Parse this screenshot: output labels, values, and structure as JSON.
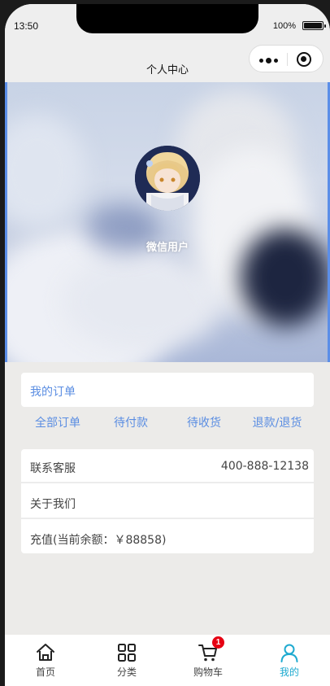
{
  "status_bar": {
    "time": "13:50",
    "battery_text": "100%",
    "battery_level": 1.0
  },
  "nav": {
    "title": "个人中心"
  },
  "profile": {
    "username": "微信用户"
  },
  "orders": {
    "title": "我的订单",
    "tabs": [
      "全部订单",
      "待付款",
      "待收货",
      "退款/退货"
    ]
  },
  "menu": {
    "service_label": "联系客服",
    "service_phone": "400-888-12138",
    "about_label": "关于我们",
    "recharge_label": "充值(当前余额：￥88858)"
  },
  "tabbar": {
    "items": [
      {
        "label": "首页",
        "icon": "home-icon"
      },
      {
        "label": "分类",
        "icon": "grid-icon"
      },
      {
        "label": "购物车",
        "icon": "cart-icon",
        "badge": "1"
      },
      {
        "label": "我的",
        "icon": "user-icon",
        "active": true
      }
    ]
  },
  "colors": {
    "accent": "#5a8de2",
    "active_tab": "#1eaad0",
    "badge": "#e60012",
    "page_bg": "#ecebe9"
  }
}
